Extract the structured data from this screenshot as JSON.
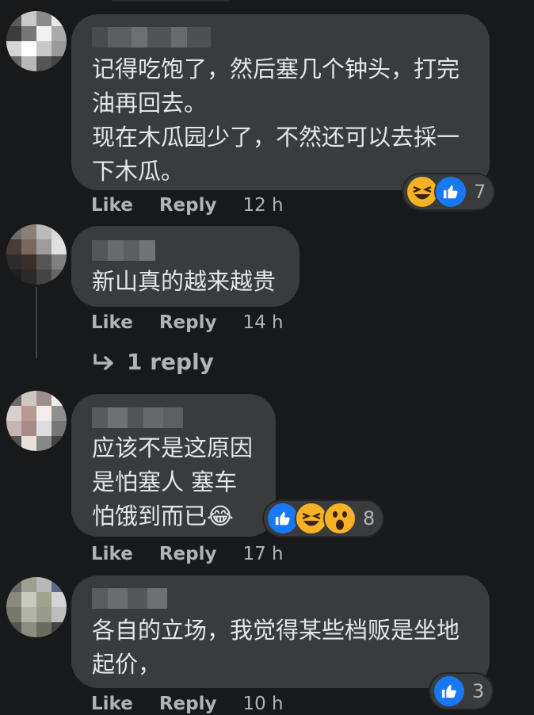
{
  "comments": [
    {
      "text": "记得吃饱了，然后塞几个钟头，打完\n油再回去。\n现在木瓜园少了，不然还可以去採一\n下木瓜。",
      "like_label": "Like",
      "reply_label": "Reply",
      "time": "12 h",
      "reactions": [
        "haha",
        "like"
      ],
      "reaction_count": "7"
    },
    {
      "text": "新山真的越来越贵",
      "like_label": "Like",
      "reply_label": "Reply",
      "time": "14 h",
      "replies_label": "1 reply"
    },
    {
      "text": "应该不是这原因\n是怕塞人 塞车\n怕饿到而已😂",
      "like_label": "Like",
      "reply_label": "Reply",
      "time": "17 h",
      "reactions": [
        "like",
        "haha",
        "wow"
      ],
      "reaction_count": "8"
    },
    {
      "text": "各自的立场，我觉得某些档贩是坐地\n起价，",
      "like_label": "Like",
      "reply_label": "Reply",
      "time": "10 h",
      "reactions": [
        "like"
      ],
      "reaction_count": "3"
    }
  ],
  "colors": {
    "background": "#18191a",
    "bubble": "#3a3b3c",
    "text": "#e4e6eb",
    "secondary_text": "#b0b3b8",
    "like_blue": "#1877f2",
    "emoji_yellow": "#f7b125"
  },
  "icons": [
    "thumbs-up-icon",
    "haha-emoji-icon",
    "wow-emoji-icon",
    "reply-arrow-icon"
  ]
}
